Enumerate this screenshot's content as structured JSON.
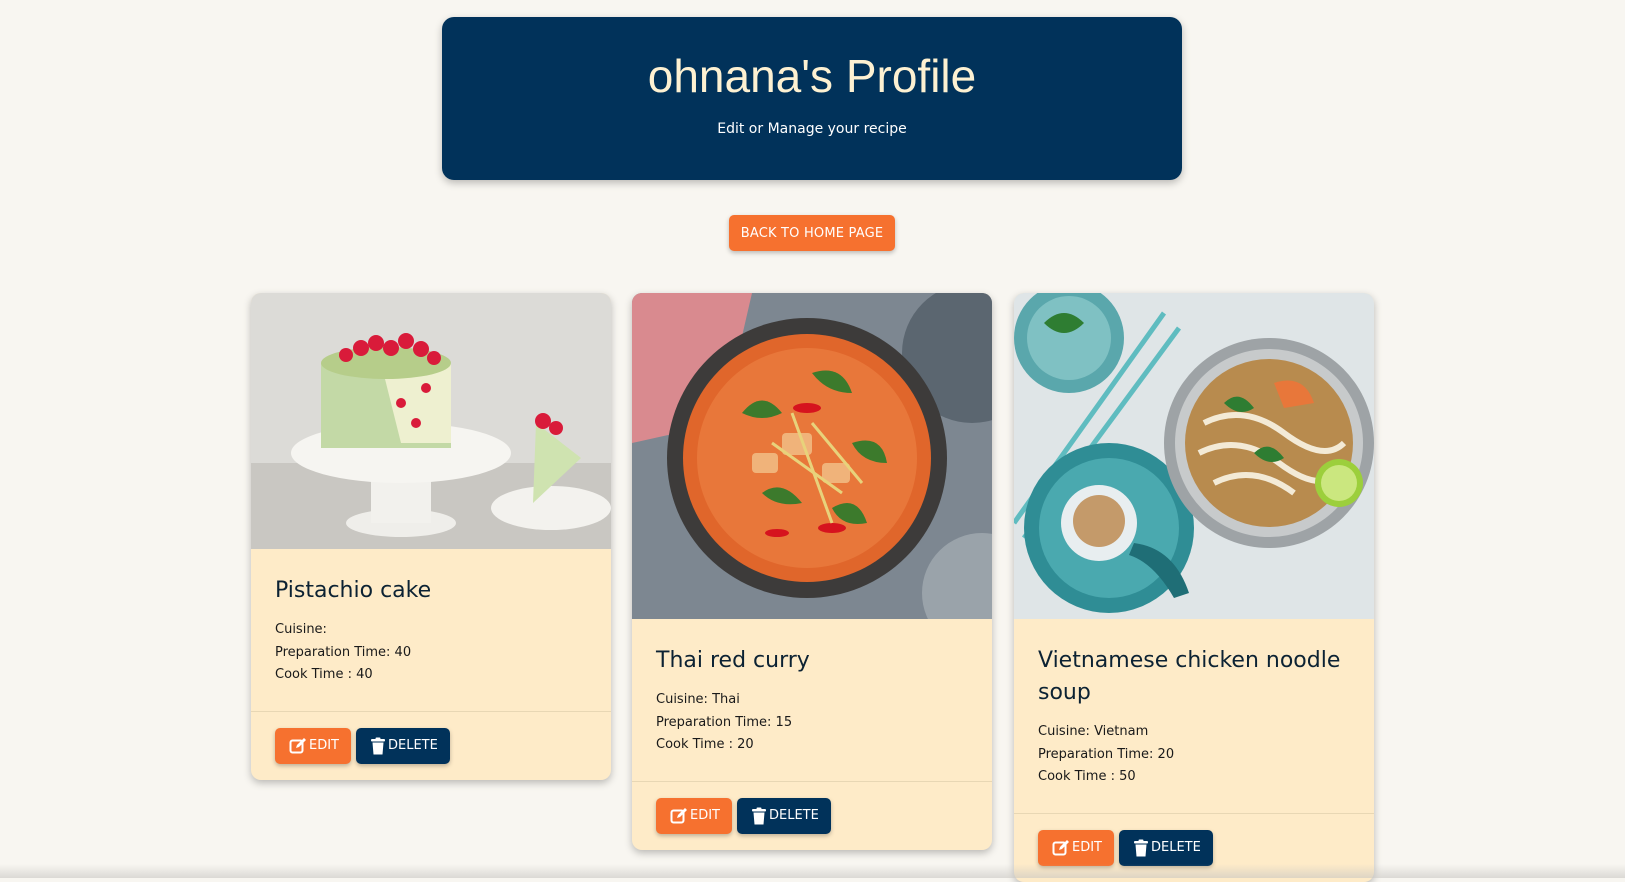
{
  "header": {
    "title": "ohnana's Profile",
    "subtitle": "Edit or Manage your recipe"
  },
  "back_button": {
    "label": "BACK TO HOME PAGE"
  },
  "colors": {
    "navy": "#01325a",
    "orange": "#f6712f",
    "card_bg": "#feebc8",
    "page_bg": "#f8f6f1"
  },
  "recipes": [
    {
      "title": "Pistachio cake",
      "cuisine": "Cuisine: ",
      "prep": "Preparation Time: 40",
      "cook": "Cook Time : 40",
      "edit_label": "EDIT",
      "delete_label": "DELETE"
    },
    {
      "title": "Thai red curry",
      "cuisine": "Cuisine: Thai",
      "prep": "Preparation Time: 15",
      "cook": "Cook Time : 20",
      "edit_label": "EDIT",
      "delete_label": "DELETE"
    },
    {
      "title": "Vietnamese chicken noodle soup",
      "cuisine": "Cuisine: Vietnam",
      "prep": "Preparation Time: 20",
      "cook": "Cook Time : 50",
      "edit_label": "EDIT",
      "delete_label": "DELETE"
    }
  ]
}
